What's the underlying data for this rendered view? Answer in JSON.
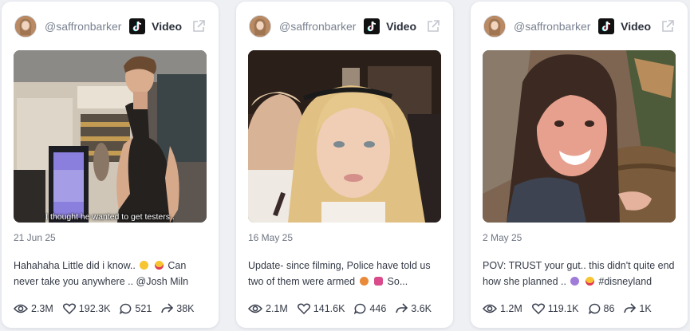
{
  "posts": [
    {
      "handle": "@saffronbarker",
      "platform": "Video",
      "overlay_caption": "I thought he wanted to get testers..",
      "date": "21 Jun 25",
      "text_a": "Hahahaha Little did i know..",
      "text_b": "Can never take you anywhere .. @Josh Miln",
      "stats": {
        "views": "2.3M",
        "likes": "192.3K",
        "comments": "521",
        "shares": "38K"
      }
    },
    {
      "handle": "@saffronbarker",
      "platform": "Video",
      "date": "16 May 25",
      "text_a": "Update- since filming, Police have told us two of them were armed",
      "text_b": "So...",
      "stats": {
        "views": "2.1M",
        "likes": "141.6K",
        "comments": "446",
        "shares": "3.6K"
      }
    },
    {
      "handle": "@saffronbarker",
      "platform": "Video",
      "date": "2 May 25",
      "text_a": "POV: TRUST your gut.. this didn't quite end how she planned ..",
      "text_b": "#disneyland",
      "stats": {
        "views": "1.2M",
        "likes": "119.1K",
        "comments": "86",
        "shares": "1K"
      }
    }
  ],
  "icons": {
    "platform_icon": "tiktok-icon",
    "external": "external-link-icon",
    "views": "eye-icon",
    "likes": "heart-icon",
    "comments": "comment-icon",
    "shares": "share-icon"
  },
  "colors": {
    "emoji_yellow": "#f7c531",
    "emoji_red": "#e03a57",
    "emoji_pink": "#d94b8a"
  }
}
